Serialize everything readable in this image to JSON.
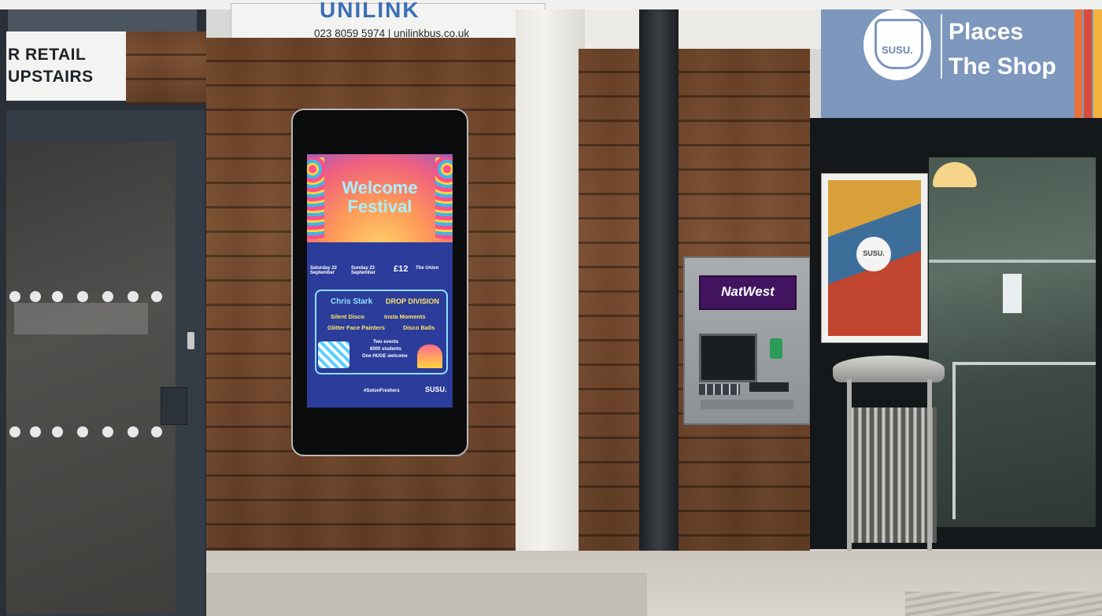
{
  "left_sign": {
    "line1": "R RETAIL",
    "line2": "UPSTAIRS"
  },
  "bus_sign": {
    "brand": "UNILINK",
    "contact": "023 8059 5974 | unilinkbus.co.uk"
  },
  "screen": {
    "title_line1": "Welcome",
    "title_line2": "Festival",
    "date1": "Saturday 22 September",
    "date2": "Sunday 23 September",
    "price": "£12",
    "venue": "The Union",
    "act1": "Chris Stark",
    "act2": "DROP DIVISION",
    "act3": "Silent Disco",
    "act4": "Insta Moments",
    "act5": "Glitter Face Painters",
    "act6": "Disco Balls",
    "info1": "Two events",
    "info2": "6000 students",
    "info3": "One HUGE welcome",
    "hashtag": "#SotonFreshers",
    "logo": "SUSU."
  },
  "atm": {
    "brand": "NatWest"
  },
  "shop_sign": {
    "logo": "SUSU.",
    "line1": "Places",
    "line2": "The Shop"
  },
  "poster": {
    "logo": "SUSU."
  },
  "colors": {
    "natwest_purple": "#42145f",
    "susu_blue": "#7d97bd",
    "screen_blue": "#2c3c9a"
  }
}
